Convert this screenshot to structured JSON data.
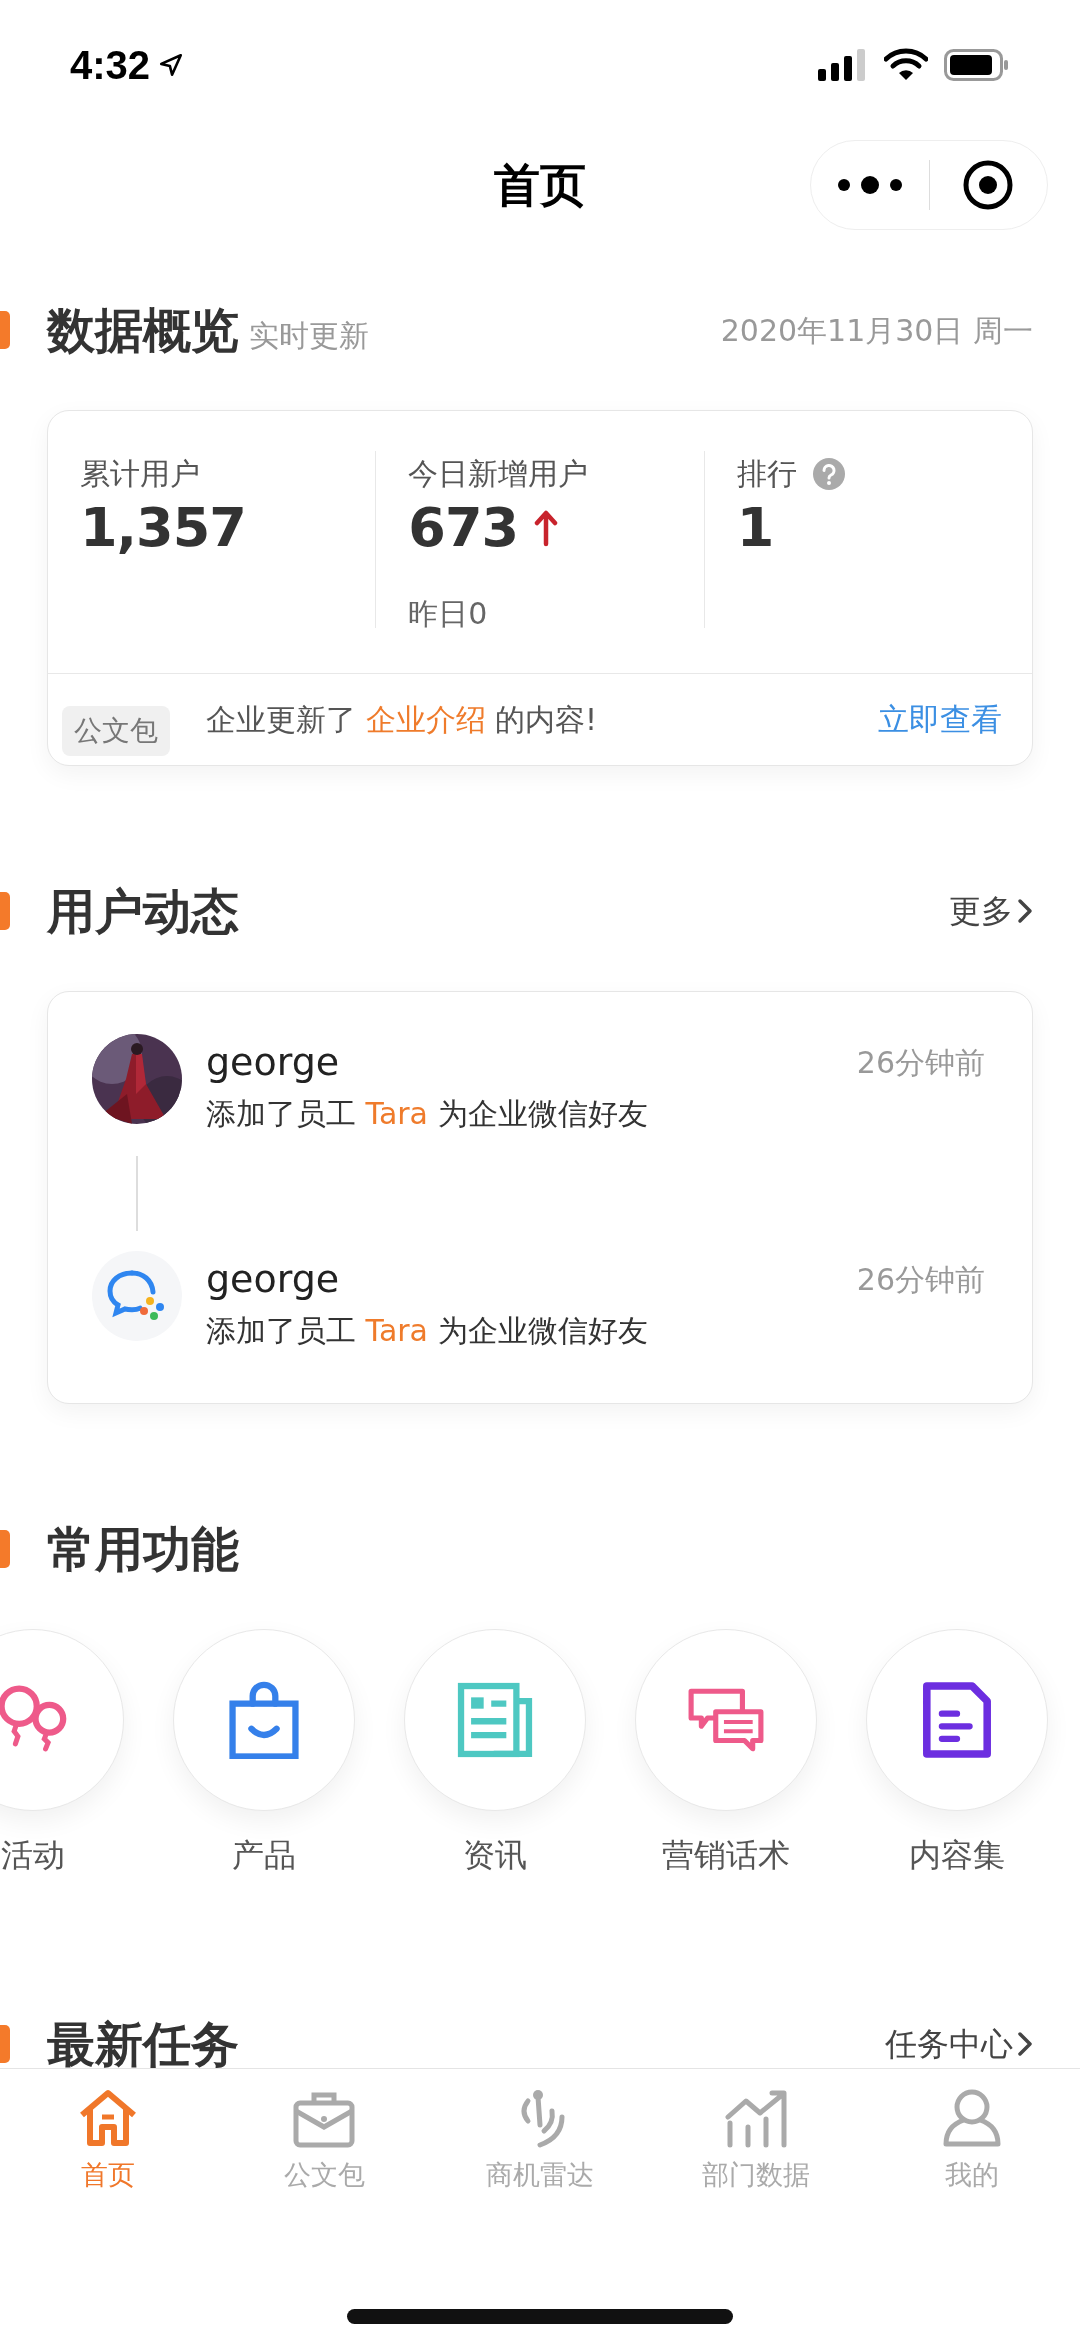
{
  "status_bar": {
    "time": "4:32"
  },
  "nav": {
    "title": "首页"
  },
  "overview": {
    "title": "数据概览",
    "subtitle": "实时更新",
    "date": "2020年11月30日 周一",
    "stats": [
      {
        "label": "累计用户",
        "value": "1,357"
      },
      {
        "label": "今日新增用户",
        "value": "673",
        "rising": true,
        "note": "昨日0"
      },
      {
        "label": "排行",
        "value": "1",
        "help": true
      }
    ],
    "notice": {
      "tag": "公文包",
      "text_before": "企业更新了",
      "highlight": "企业介绍",
      "text_after": "的内容!",
      "link": "立即查看"
    }
  },
  "activity": {
    "title": "用户动态",
    "more": "更多",
    "items": [
      {
        "name": "george",
        "time": "26分钟前",
        "text_before": "添加了员工",
        "target": "Tara",
        "text_after": "为企业微信好友"
      },
      {
        "kind": "app",
        "name": "george",
        "time": "26分钟前",
        "text_before": "添加了员工",
        "target": "Tara",
        "text_after": "为企业微信好友"
      }
    ]
  },
  "functions": {
    "title": "常用功能",
    "items": [
      {
        "kind": "balloons",
        "label": "活动"
      },
      {
        "kind": "bag",
        "label": "产品"
      },
      {
        "kind": "news",
        "label": "资讯"
      },
      {
        "kind": "chat",
        "label": "营销话术"
      },
      {
        "kind": "doc",
        "label": "内容集"
      }
    ]
  },
  "tasks": {
    "title": "最新任务",
    "more": "任务中心"
  },
  "tabs": [
    {
      "kind": "home",
      "label": "首页",
      "selected": true
    },
    {
      "kind": "briefcase",
      "label": "公文包",
      "selected": false
    },
    {
      "kind": "radar",
      "label": "商机雷达",
      "selected": false
    },
    {
      "kind": "chart",
      "label": "部门数据",
      "selected": false
    },
    {
      "kind": "user",
      "label": "我的",
      "selected": false
    }
  ]
}
